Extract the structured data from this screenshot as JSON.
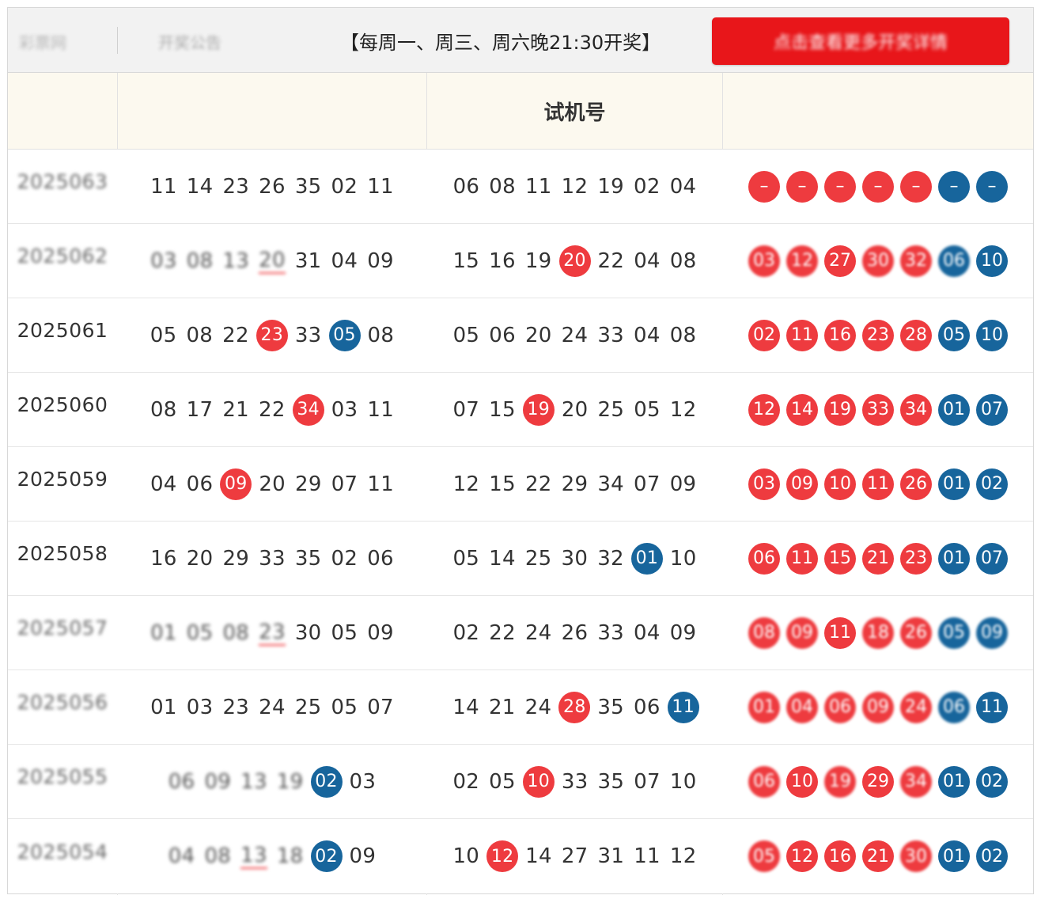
{
  "topbar": {
    "left_label": "彩票网",
    "mid_label": "开奖公告",
    "schedule": "【每周一、周三、周六晚21:30开奖】",
    "button_label": "点击查看更多开奖详情"
  },
  "header": {
    "col0": "",
    "col1": "",
    "col2": "试机号",
    "col3": ""
  },
  "rows": [
    {
      "period": "2025063",
      "period_blurred": true,
      "draw": [
        {
          "v": "11"
        },
        {
          "v": "14"
        },
        {
          "v": "23"
        },
        {
          "v": "26"
        },
        {
          "v": "35"
        },
        {
          "v": "02"
        },
        {
          "v": "11"
        }
      ],
      "test": [
        {
          "v": "06"
        },
        {
          "v": "08"
        },
        {
          "v": "11"
        },
        {
          "v": "12"
        },
        {
          "v": "19"
        },
        {
          "v": "02"
        },
        {
          "v": "04"
        }
      ],
      "balls": [
        {
          "v": "–",
          "c": "red"
        },
        {
          "v": "–",
          "c": "red"
        },
        {
          "v": "–",
          "c": "red"
        },
        {
          "v": "–",
          "c": "red"
        },
        {
          "v": "–",
          "c": "red"
        },
        {
          "v": "–",
          "c": "blue"
        },
        {
          "v": "–",
          "c": "blue"
        }
      ]
    },
    {
      "period": "2025062",
      "period_blurred": true,
      "draw": [
        {
          "v": "03",
          "blur": true
        },
        {
          "v": "08",
          "blur": true
        },
        {
          "v": "13",
          "blur": true
        },
        {
          "v": "20",
          "blur": true,
          "mark": "red-underline"
        },
        {
          "v": "31"
        },
        {
          "v": "04"
        },
        {
          "v": "09"
        }
      ],
      "test": [
        {
          "v": "15"
        },
        {
          "v": "16"
        },
        {
          "v": "19"
        },
        {
          "v": "20",
          "ball": "red"
        },
        {
          "v": "22"
        },
        {
          "v": "04"
        },
        {
          "v": "08"
        }
      ],
      "balls": [
        {
          "v": "03",
          "c": "red",
          "blur": true
        },
        {
          "v": "12",
          "c": "red",
          "blur": true
        },
        {
          "v": "27",
          "c": "red"
        },
        {
          "v": "30",
          "c": "red",
          "blur": true
        },
        {
          "v": "32",
          "c": "red",
          "blur": true
        },
        {
          "v": "06",
          "c": "blue",
          "blur": true
        },
        {
          "v": "10",
          "c": "blue"
        }
      ]
    },
    {
      "period": "2025061",
      "period_blurred": false,
      "draw": [
        {
          "v": "05"
        },
        {
          "v": "08"
        },
        {
          "v": "22"
        },
        {
          "v": "23",
          "ball": "red"
        },
        {
          "v": "33"
        },
        {
          "v": "05",
          "ball": "blue"
        },
        {
          "v": "08"
        }
      ],
      "test": [
        {
          "v": "05"
        },
        {
          "v": "06"
        },
        {
          "v": "20"
        },
        {
          "v": "24"
        },
        {
          "v": "33"
        },
        {
          "v": "04"
        },
        {
          "v": "08"
        }
      ],
      "balls": [
        {
          "v": "02",
          "c": "red"
        },
        {
          "v": "11",
          "c": "red"
        },
        {
          "v": "16",
          "c": "red"
        },
        {
          "v": "23",
          "c": "red"
        },
        {
          "v": "28",
          "c": "red"
        },
        {
          "v": "05",
          "c": "blue"
        },
        {
          "v": "10",
          "c": "blue"
        }
      ]
    },
    {
      "period": "2025060",
      "period_blurred": false,
      "draw": [
        {
          "v": "08"
        },
        {
          "v": "17"
        },
        {
          "v": "21"
        },
        {
          "v": "22"
        },
        {
          "v": "34",
          "ball": "red"
        },
        {
          "v": "03"
        },
        {
          "v": "11"
        }
      ],
      "test": [
        {
          "v": "07"
        },
        {
          "v": "15"
        },
        {
          "v": "19",
          "ball": "red"
        },
        {
          "v": "20"
        },
        {
          "v": "25"
        },
        {
          "v": "05"
        },
        {
          "v": "12"
        }
      ],
      "balls": [
        {
          "v": "12",
          "c": "red"
        },
        {
          "v": "14",
          "c": "red"
        },
        {
          "v": "19",
          "c": "red"
        },
        {
          "v": "33",
          "c": "red"
        },
        {
          "v": "34",
          "c": "red"
        },
        {
          "v": "01",
          "c": "blue"
        },
        {
          "v": "07",
          "c": "blue"
        }
      ]
    },
    {
      "period": "2025059",
      "period_blurred": false,
      "draw": [
        {
          "v": "04"
        },
        {
          "v": "06"
        },
        {
          "v": "09",
          "ball": "red"
        },
        {
          "v": "20"
        },
        {
          "v": "29"
        },
        {
          "v": "07"
        },
        {
          "v": "11"
        }
      ],
      "test": [
        {
          "v": "12"
        },
        {
          "v": "15"
        },
        {
          "v": "22"
        },
        {
          "v": "29"
        },
        {
          "v": "34"
        },
        {
          "v": "07"
        },
        {
          "v": "09"
        }
      ],
      "balls": [
        {
          "v": "03",
          "c": "red"
        },
        {
          "v": "09",
          "c": "red"
        },
        {
          "v": "10",
          "c": "red"
        },
        {
          "v": "11",
          "c": "red"
        },
        {
          "v": "26",
          "c": "red"
        },
        {
          "v": "01",
          "c": "blue"
        },
        {
          "v": "02",
          "c": "blue"
        }
      ]
    },
    {
      "period": "2025058",
      "period_blurred": false,
      "draw": [
        {
          "v": "16"
        },
        {
          "v": "20"
        },
        {
          "v": "29"
        },
        {
          "v": "33"
        },
        {
          "v": "35"
        },
        {
          "v": "02"
        },
        {
          "v": "06"
        }
      ],
      "test": [
        {
          "v": "05"
        },
        {
          "v": "14"
        },
        {
          "v": "25"
        },
        {
          "v": "30"
        },
        {
          "v": "32"
        },
        {
          "v": "01",
          "ball": "blue"
        },
        {
          "v": "10"
        }
      ],
      "balls": [
        {
          "v": "06",
          "c": "red"
        },
        {
          "v": "11",
          "c": "red"
        },
        {
          "v": "15",
          "c": "red"
        },
        {
          "v": "21",
          "c": "red"
        },
        {
          "v": "23",
          "c": "red"
        },
        {
          "v": "01",
          "c": "blue"
        },
        {
          "v": "07",
          "c": "blue"
        }
      ]
    },
    {
      "period": "2025057",
      "period_blurred": true,
      "draw": [
        {
          "v": "01",
          "blur": true
        },
        {
          "v": "05",
          "blur": true
        },
        {
          "v": "08",
          "blur": true
        },
        {
          "v": "23",
          "blur": true,
          "mark": "red-underline"
        },
        {
          "v": "30"
        },
        {
          "v": "05"
        },
        {
          "v": "09"
        }
      ],
      "test": [
        {
          "v": "02"
        },
        {
          "v": "22"
        },
        {
          "v": "24"
        },
        {
          "v": "26"
        },
        {
          "v": "33"
        },
        {
          "v": "04"
        },
        {
          "v": "09"
        }
      ],
      "balls": [
        {
          "v": "08",
          "c": "red",
          "blur": true
        },
        {
          "v": "09",
          "c": "red",
          "blur": true
        },
        {
          "v": "11",
          "c": "red"
        },
        {
          "v": "18",
          "c": "red",
          "blur": true
        },
        {
          "v": "26",
          "c": "red",
          "blur": true
        },
        {
          "v": "05",
          "c": "blue",
          "blur": true
        },
        {
          "v": "09",
          "c": "blue",
          "blur": true
        }
      ]
    },
    {
      "period": "2025056",
      "period_blurred": true,
      "draw": [
        {
          "v": "01"
        },
        {
          "v": "03"
        },
        {
          "v": "23"
        },
        {
          "v": "24"
        },
        {
          "v": "25"
        },
        {
          "v": "05"
        },
        {
          "v": "07"
        }
      ],
      "test": [
        {
          "v": "14"
        },
        {
          "v": "21"
        },
        {
          "v": "24"
        },
        {
          "v": "28",
          "ball": "red"
        },
        {
          "v": "35"
        },
        {
          "v": "06"
        },
        {
          "v": "11",
          "ball": "blue"
        }
      ],
      "balls": [
        {
          "v": "01",
          "c": "red",
          "blur": true
        },
        {
          "v": "04",
          "c": "red",
          "blur": true
        },
        {
          "v": "06",
          "c": "red",
          "blur": true
        },
        {
          "v": "09",
          "c": "red",
          "blur": true
        },
        {
          "v": "24",
          "c": "red",
          "blur": true
        },
        {
          "v": "06",
          "c": "blue",
          "blur": true
        },
        {
          "v": "11",
          "c": "blue"
        }
      ]
    },
    {
      "period": "2025055",
      "period_blurred": true,
      "draw": [
        {
          "v": "06",
          "blur": true
        },
        {
          "v": "09",
          "blur": true
        },
        {
          "v": "13",
          "blur": true
        },
        {
          "v": "19",
          "blur": true
        },
        {
          "v": "02",
          "ball": "blue"
        },
        {
          "v": "03"
        }
      ],
      "test": [
        {
          "v": "02"
        },
        {
          "v": "05"
        },
        {
          "v": "10",
          "ball": "red"
        },
        {
          "v": "33"
        },
        {
          "v": "35"
        },
        {
          "v": "07"
        },
        {
          "v": "10"
        }
      ],
      "balls": [
        {
          "v": "06",
          "c": "red",
          "blur": true
        },
        {
          "v": "10",
          "c": "red"
        },
        {
          "v": "19",
          "c": "red",
          "blur": true
        },
        {
          "v": "29",
          "c": "red"
        },
        {
          "v": "34",
          "c": "red",
          "blur": true
        },
        {
          "v": "01",
          "c": "blue"
        },
        {
          "v": "02",
          "c": "blue"
        }
      ]
    },
    {
      "period": "2025054",
      "period_blurred": true,
      "draw": [
        {
          "v": "04",
          "blur": true
        },
        {
          "v": "08",
          "blur": true
        },
        {
          "v": "13",
          "blur": true,
          "mark": "red-underline"
        },
        {
          "v": "18",
          "blur": true
        },
        {
          "v": "02",
          "ball": "blue"
        },
        {
          "v": "09"
        }
      ],
      "test": [
        {
          "v": "10"
        },
        {
          "v": "12",
          "ball": "red"
        },
        {
          "v": "14"
        },
        {
          "v": "27"
        },
        {
          "v": "31"
        },
        {
          "v": "11"
        },
        {
          "v": "12"
        }
      ],
      "balls": [
        {
          "v": "05",
          "c": "red",
          "blur": true
        },
        {
          "v": "12",
          "c": "red"
        },
        {
          "v": "16",
          "c": "red"
        },
        {
          "v": "21",
          "c": "red"
        },
        {
          "v": "30",
          "c": "red",
          "blur": true
        },
        {
          "v": "01",
          "c": "blue"
        },
        {
          "v": "02",
          "c": "blue"
        }
      ]
    }
  ],
  "colors": {
    "red_ball": "#ee3b3f",
    "blue_ball": "#17659c",
    "header_bg": "#fcf9ef",
    "button_red": "#e8161a"
  }
}
